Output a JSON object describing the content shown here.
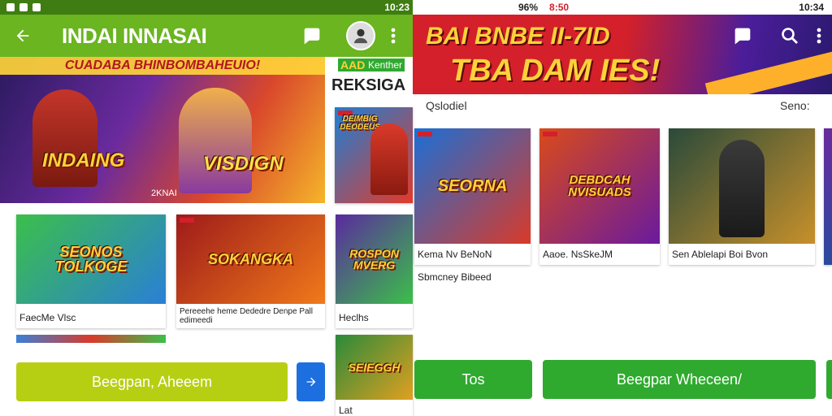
{
  "left": {
    "status": {
      "time": "10:23"
    },
    "toolbar": {
      "title": "INDAI INNASAI",
      "back_icon": "arrow-left-icon",
      "chat_icon": "chat-bubble-icon",
      "avatar_icon": "avatar-icon",
      "more_icon": "more-vertical-icon"
    },
    "hero": {
      "headline": "CUADABA BHINBOMBAHEUIO!",
      "banner_left": "INDAING",
      "banner_right": "VISDIGN",
      "caption": "2KNAI"
    },
    "side_promo": {
      "line1": "AAD",
      "line1b": "Kenther",
      "line2": "REKSIGA"
    },
    "side_tile": {
      "text": "DEIMBIG DEODEUS"
    },
    "cards": [
      {
        "image_text": "SEONOS TOLKOGE",
        "label": "FaecMe Vlsc"
      },
      {
        "image_text": "SOKANGKA",
        "label": "Pereeehe heme Dededre Denpe Pall edimeedi"
      },
      {
        "image_text": "ROSPON MVERG",
        "label": "Heclhs"
      }
    ],
    "lower_tile": {
      "image_text": "SEIEGGH",
      "label": "Lat"
    },
    "primary_button": "Beegpan, Aheeem",
    "arrow_button_icon": "arrow-right-icon"
  },
  "right": {
    "status": {
      "time": "10:34",
      "battery": "96%",
      "alert": "8:50"
    },
    "banner": {
      "line1": "BAI BNBE II-7ID",
      "line2": "TBA DAM IES!"
    },
    "toolbar": {
      "chat_icon": "chat-bubble-icon",
      "search_icon": "search-icon",
      "more_icon": "more-vertical-icon"
    },
    "section": {
      "left": "Qslodiel",
      "right": "Seno:"
    },
    "cards": [
      {
        "image_text": "SEORNA",
        "label": "Kema Nv BeNoN",
        "sub": "Sbmcney Bibeed"
      },
      {
        "image_text": "DEBDCAH NVISUADS",
        "label": "Aaoe. NsSkeJM"
      },
      {
        "image_text": "",
        "label": "Sen Ablelapi Boi Bvon"
      }
    ],
    "buttons": {
      "left": "Tos",
      "main": "Beegpar Wheceen/"
    }
  },
  "colors": {
    "green_dark": "#3f7d12",
    "green_toolbar": "#6ab520",
    "lime_button": "#b7cf12",
    "green_button": "#2faa2f",
    "blue_button": "#1d6fe0",
    "banner_red": "#d3202a",
    "banner_purple": "#4b1d9a",
    "banner_yellow": "#ffd23a"
  }
}
